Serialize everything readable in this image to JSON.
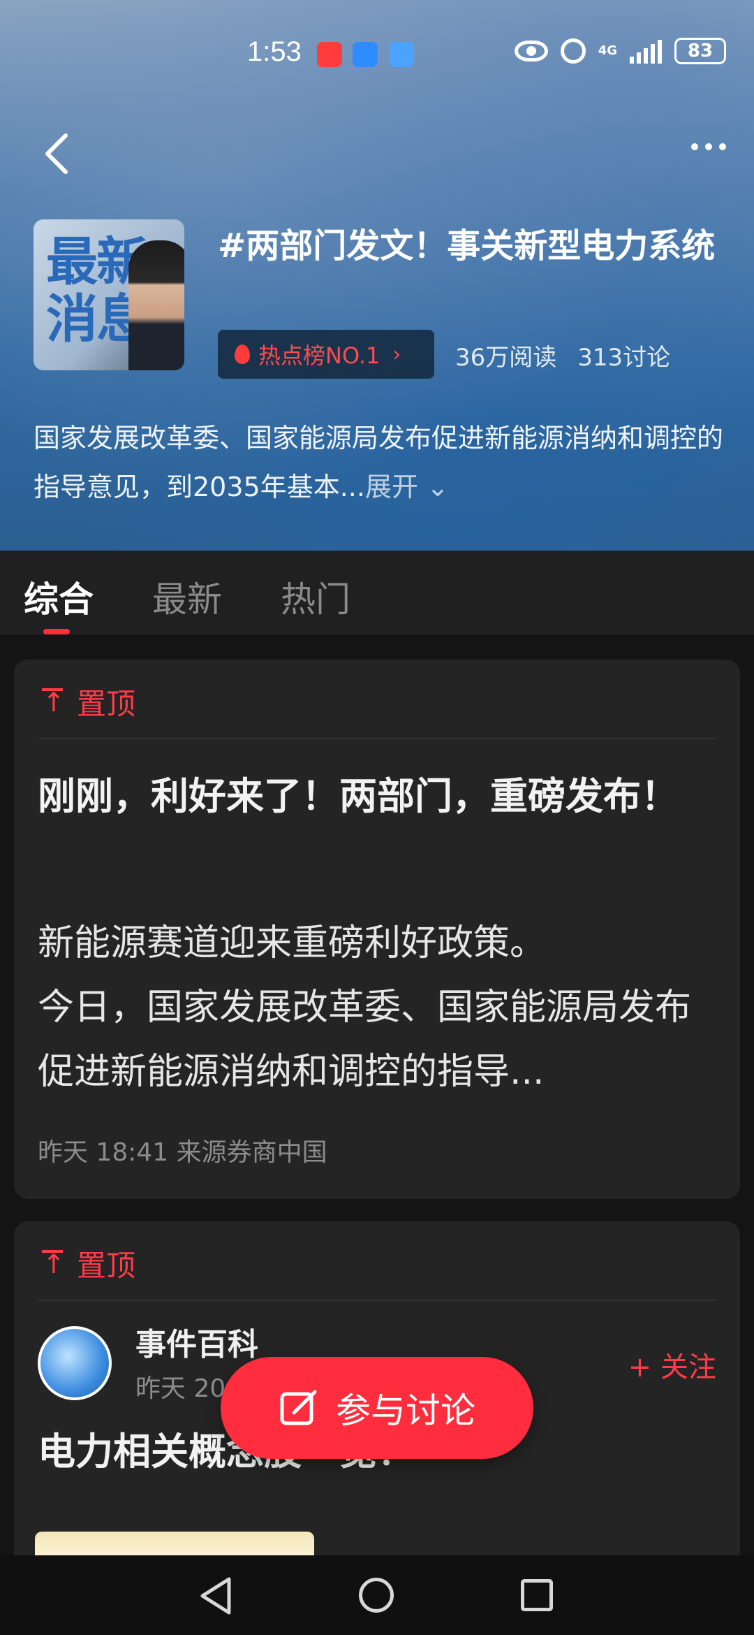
{
  "status_bar": {
    "time": "1:53",
    "network": "4G",
    "battery": "83",
    "icons": [
      "app-red-icon",
      "app-blue-icon",
      "app-chart-icon",
      "eye-icon",
      "alarm-icon",
      "signal-icon",
      "battery-icon"
    ]
  },
  "header": {
    "back_icon": "chevron-left-icon",
    "more_icon": "more-dots-icon",
    "cover_text": "最新\n消息",
    "topic_title": "#两部门发文！事关新型电力系统",
    "hot_badge": "热点榜NO.1",
    "reads": "36万阅读",
    "discussions": "313讨论",
    "description": "国家发展改革委、国家能源局发布促进新能源消纳和调控的指导意见，到2035年基本...",
    "expand_label": "展开"
  },
  "tabs": [
    {
      "label": "综合",
      "active": true
    },
    {
      "label": "最新",
      "active": false
    },
    {
      "label": "热门",
      "active": false
    }
  ],
  "posts": [
    {
      "pinned_label": "置顶",
      "headline": "刚刚，利好来了！两部门，重磅发布！",
      "body_line1": "新能源赛道迎来重磅利好政策。",
      "body_line2": "今日，国家发展改革委、国家能源局发布促进新能源消纳和调控的指导...",
      "meta": "昨天 18:41 来源券商中国"
    },
    {
      "pinned_label": "置顶",
      "author": "事件百科",
      "time": "昨天 20",
      "follow_label": "+ 关注",
      "headline": "电力相关概念股一览！"
    }
  ],
  "fab": {
    "label": "参与讨论",
    "icon": "edit-icon"
  },
  "colors": {
    "accent": "#ff2d3d",
    "background": "#141414",
    "card": "#242424"
  }
}
